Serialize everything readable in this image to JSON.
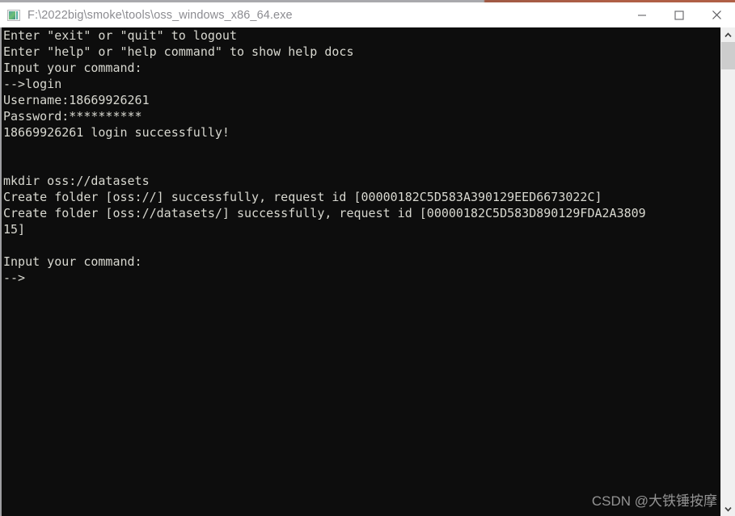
{
  "window": {
    "title": "F:\\2022big\\smoke\\tools\\oss_windows_x86_64.exe",
    "icon": "console-app-icon",
    "controls": {
      "minimize": "minimize-button",
      "maximize": "maximize-button",
      "close": "close-button"
    },
    "colors": {
      "titlebar_bg": "#ffffff",
      "title_text": "#8c8c91",
      "console_bg": "#0d0d0d",
      "console_text": "#d8d8d0",
      "accent_border_left": "#a9a9ad",
      "accent_border_right": "#b05f46",
      "scrollbar_track": "#f0f0f0",
      "scrollbar_thumb": "#cdcdcd"
    }
  },
  "console": {
    "lines": [
      "Enter \"exit\" or \"quit\" to logout",
      "Enter \"help\" or \"help command\" to show help docs",
      "Input your command:",
      "-->login",
      "Username:18669926261",
      "Password:**********",
      "18669926261 login successfully!",
      "",
      "",
      "mkdir oss://datasets",
      "Create folder [oss://] successfully, request id [00000182C5D583A390129EED6673022C]",
      "Create folder [oss://datasets/] successfully, request id [00000182C5D583D890129FDA2A3809",
      "15]",
      "",
      "Input your command:",
      "-->"
    ]
  },
  "scrollbar": {
    "up_arrow": "scroll-up-arrow-icon",
    "down_arrow": "scroll-down-arrow-icon",
    "thumb": "scrollbar-thumb"
  },
  "watermark": {
    "text": "CSDN @大铁锤按摩"
  }
}
